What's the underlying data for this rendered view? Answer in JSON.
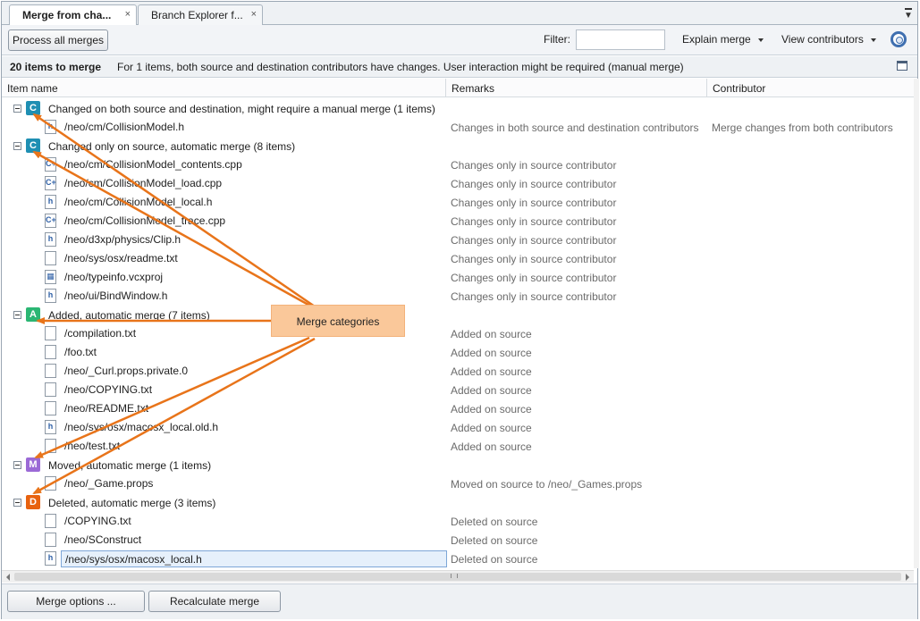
{
  "tabs": [
    {
      "label": "Merge from cha...",
      "close": "×"
    },
    {
      "label": "Branch Explorer f...",
      "close": "×"
    }
  ],
  "toolbar": {
    "process_all": "Process all merges",
    "filter_label": "Filter:",
    "filter_value": "",
    "explain_merge": "Explain merge",
    "view_contributors": "View contributors"
  },
  "summary": {
    "count": "20 items to merge",
    "message": "For 1 items, both source and destination contributors have changes. User interaction might be required (manual merge)"
  },
  "columns": [
    "Item name",
    "Remarks",
    "Contributor"
  ],
  "categories": [
    {
      "badge": "C",
      "color": "#1f8fb3",
      "label": "Changed on both source and destination, might require a manual merge (1 items)",
      "items": [
        {
          "icon": "h",
          "name": "/neo/cm/CollisionModel.h",
          "remark": "Changes in both source and destination contributors",
          "contributor": "Merge changes from both contributors"
        }
      ]
    },
    {
      "badge": "C",
      "color": "#1f8fb3",
      "label": "Changed only on source, automatic merge (8 items)",
      "items": [
        {
          "icon": "c++",
          "name": "/neo/cm/CollisionModel_contents.cpp",
          "remark": "Changes only in source contributor",
          "contributor": ""
        },
        {
          "icon": "c++",
          "name": "/neo/cm/CollisionModel_load.cpp",
          "remark": "Changes only in source contributor",
          "contributor": ""
        },
        {
          "icon": "h",
          "name": "/neo/cm/CollisionModel_local.h",
          "remark": "Changes only in source contributor",
          "contributor": ""
        },
        {
          "icon": "c++",
          "name": "/neo/cm/CollisionModel_trace.cpp",
          "remark": "Changes only in source contributor",
          "contributor": ""
        },
        {
          "icon": "h",
          "name": "/neo/d3xp/physics/Clip.h",
          "remark": "Changes only in source contributor",
          "contributor": ""
        },
        {
          "icon": "txt",
          "name": "/neo/sys/osx/readme.txt",
          "remark": "Changes only in source contributor",
          "contributor": ""
        },
        {
          "icon": "proj",
          "name": "/neo/typeinfo.vcxproj",
          "remark": "Changes only in source contributor",
          "contributor": ""
        },
        {
          "icon": "h",
          "name": "/neo/ui/BindWindow.h",
          "remark": "Changes only in source contributor",
          "contributor": ""
        }
      ]
    },
    {
      "badge": "A",
      "color": "#2bb673",
      "label": "Added, automatic merge (7 items)",
      "items": [
        {
          "icon": "txt",
          "name": "/compilation.txt",
          "remark": "Added on source",
          "contributor": ""
        },
        {
          "icon": "txt",
          "name": "/foo.txt",
          "remark": "Added on source",
          "contributor": ""
        },
        {
          "icon": "file",
          "name": "/neo/_Curl.props.private.0",
          "remark": "Added on source",
          "contributor": ""
        },
        {
          "icon": "txt",
          "name": "/neo/COPYING.txt",
          "remark": "Added on source",
          "contributor": ""
        },
        {
          "icon": "txt",
          "name": "/neo/README.txt",
          "remark": "Added on source",
          "contributor": ""
        },
        {
          "icon": "h",
          "name": "/neo/sys/osx/macosx_local.old.h",
          "remark": "Added on source",
          "contributor": ""
        },
        {
          "icon": "txt",
          "name": "/neo/test.txt",
          "remark": "Added on source",
          "contributor": ""
        }
      ]
    },
    {
      "badge": "M",
      "color": "#9b6ad6",
      "label": "Moved, automatic merge (1 items)",
      "items": [
        {
          "icon": "file",
          "name": "/neo/_Game.props",
          "remark": "Moved on source to /neo/_Games.props",
          "contributor": ""
        }
      ]
    },
    {
      "badge": "D",
      "color": "#e8620f",
      "label": "Deleted, automatic merge (3 items)",
      "items": [
        {
          "icon": "txt",
          "name": "/COPYING.txt",
          "remark": "Deleted on source",
          "contributor": ""
        },
        {
          "icon": "file",
          "name": "/neo/SConstruct",
          "remark": "Deleted on source",
          "contributor": ""
        },
        {
          "icon": "h",
          "name": "/neo/sys/osx/macosx_local.h",
          "remark": "Deleted on source",
          "contributor": "",
          "selected": true
        }
      ]
    }
  ],
  "callout": "Merge categories",
  "bottom": {
    "merge_options": "Merge options ...",
    "recalculate": "Recalculate merge"
  }
}
